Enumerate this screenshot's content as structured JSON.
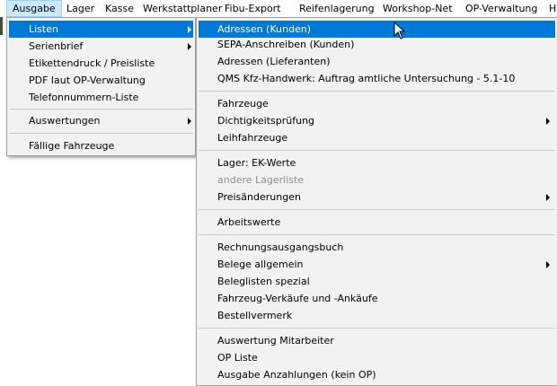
{
  "menubar": [
    "Ausgabe",
    "Lager",
    "Kasse",
    "Werkstattplaner",
    "Fibu-Export",
    "Reifenlagerung",
    "Workshop-Net",
    "OP-Verwaltung",
    "H"
  ],
  "menu1": {
    "group1": [
      "Listen",
      "Serienbrief",
      "Etikettendruck / Preisliste",
      "PDF laut OP-Verwaltung",
      "Telefonnummern-Liste"
    ],
    "group2": [
      "Auswertungen"
    ],
    "group3": [
      "Fällige Fahrzeuge"
    ]
  },
  "menu2": {
    "group1": [
      "Adressen (Kunden)",
      "SEPA-Anschreiben (Kunden)",
      "Adressen (Lieferanten)",
      "QMS Kfz-Handwerk: Auftrag amtliche Untersuchung - 5.1-10"
    ],
    "group2": [
      "Fahrzeuge",
      "Dichtigkeitsprüfung",
      "Leihfahrzeuge"
    ],
    "group3": [
      "Lager: EK-Werte",
      "andere Lagerliste",
      "Preisänderungen"
    ],
    "group4": [
      "Arbeitswerte"
    ],
    "group5": [
      "Rechnungsausgangsbuch",
      "Belege allgemein",
      "Beleglisten spezial",
      "Fahrzeug-Verkäufe und -Ankäufe",
      "Bestellvermerk"
    ],
    "group6": [
      "Auswertung Mitarbeiter",
      "OP Liste",
      "Ausgabe Anzahlungen (kein OP)"
    ]
  },
  "colors": {
    "selection": "#0078d7",
    "menubar_active": "#cce8ff",
    "menu_bg": "#f2f2f2",
    "disabled_text": "#8d8d8d"
  },
  "icons": [
    "submenu-arrow-icon",
    "mouse-pointer-icon"
  ]
}
